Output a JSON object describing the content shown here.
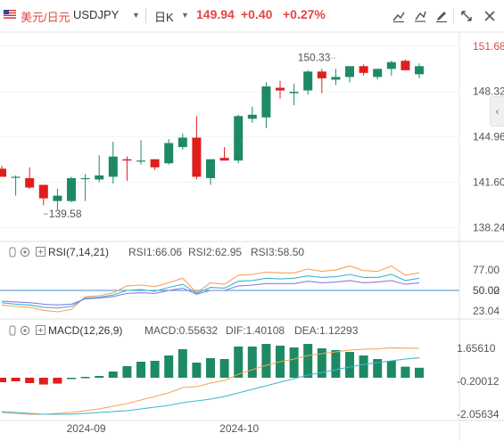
{
  "header": {
    "pair_name": "美元/日元",
    "symbol": "USDJPY",
    "period": "日K",
    "price": "149.94",
    "change": "+0.40",
    "change_pct": "+0.27%",
    "toolbar_icons": [
      "trend-line-icon",
      "bar-style-icon",
      "draw-icon",
      "eye-off-icon",
      "expand-icon",
      "close-icon"
    ]
  },
  "colors": {
    "up": "#1e8a63",
    "down": "#e01e1e",
    "accent_red": "#e34545",
    "rsi1": "#f5a35c",
    "rsi2": "#3cb6d6",
    "rsi3": "#8a7ee0",
    "macd_dif": "#f5a35c",
    "macd_dea": "#3cb6d6"
  },
  "chart_data": [
    {
      "type": "candlestick",
      "title": "",
      "y_ticks": [
        "151.68",
        "148.32",
        "144.96",
        "141.60",
        "138.24"
      ],
      "y_tick_values": [
        151.68,
        148.32,
        144.96,
        141.6,
        138.24
      ],
      "ylim": [
        137.8,
        152.2
      ],
      "x_ticks": [
        "2024-09",
        "2024-10"
      ],
      "x_tick_index": [
        6,
        17
      ],
      "annotations": [
        {
          "text": "150.33",
          "candle": 24,
          "value": 150.33,
          "kind": "high"
        },
        {
          "text": "139.58",
          "candle": 3,
          "value": 139.58,
          "kind": "low"
        }
      ],
      "candles": [
        {
          "o": 142.6,
          "h": 142.8,
          "l": 142.0,
          "c": 142.0
        },
        {
          "o": 142.0,
          "h": 142.1,
          "l": 140.6,
          "c": 142.0
        },
        {
          "o": 141.9,
          "h": 142.7,
          "l": 141.1,
          "c": 141.2
        },
        {
          "o": 141.4,
          "h": 141.4,
          "l": 139.9,
          "c": 140.4
        },
        {
          "o": 140.2,
          "h": 141.1,
          "l": 139.58,
          "c": 140.6
        },
        {
          "o": 140.2,
          "h": 142.0,
          "l": 140.1,
          "c": 141.9
        },
        {
          "o": 141.9,
          "h": 142.2,
          "l": 140.2,
          "c": 141.9
        },
        {
          "o": 141.8,
          "h": 143.6,
          "l": 141.6,
          "c": 142.1
        },
        {
          "o": 142.0,
          "h": 144.6,
          "l": 141.5,
          "c": 143.5
        },
        {
          "o": 143.3,
          "h": 143.5,
          "l": 141.7,
          "c": 143.2
        },
        {
          "o": 143.2,
          "h": 144.7,
          "l": 142.9,
          "c": 143.2
        },
        {
          "o": 143.3,
          "h": 143.3,
          "l": 142.5,
          "c": 142.7
        },
        {
          "o": 143.0,
          "h": 144.8,
          "l": 142.9,
          "c": 144.5
        },
        {
          "o": 144.2,
          "h": 145.2,
          "l": 144.0,
          "c": 144.9
        },
        {
          "o": 144.9,
          "h": 146.5,
          "l": 141.8,
          "c": 142.0
        },
        {
          "o": 141.9,
          "h": 143.3,
          "l": 141.4,
          "c": 143.3
        },
        {
          "o": 143.4,
          "h": 144.2,
          "l": 143.3,
          "c": 143.2
        },
        {
          "o": 143.2,
          "h": 146.6,
          "l": 143.0,
          "c": 146.5
        },
        {
          "o": 146.3,
          "h": 147.2,
          "l": 146.0,
          "c": 146.6
        },
        {
          "o": 146.4,
          "h": 149.0,
          "l": 145.6,
          "c": 148.7
        },
        {
          "o": 148.6,
          "h": 149.1,
          "l": 147.8,
          "c": 148.4
        },
        {
          "o": 148.2,
          "h": 148.9,
          "l": 147.3,
          "c": 148.3
        },
        {
          "o": 148.4,
          "h": 149.9,
          "l": 148.1,
          "c": 149.8
        },
        {
          "o": 149.8,
          "h": 150.0,
          "l": 148.2,
          "c": 149.3
        },
        {
          "o": 149.2,
          "h": 150.0,
          "l": 148.8,
          "c": 149.4
        },
        {
          "o": 149.4,
          "h": 150.1,
          "l": 149.0,
          "c": 150.2
        },
        {
          "o": 150.2,
          "h": 150.33,
          "l": 149.5,
          "c": 149.7
        },
        {
          "o": 149.4,
          "h": 150.0,
          "l": 149.2,
          "c": 150.0
        },
        {
          "o": 150.0,
          "h": 150.6,
          "l": 149.5,
          "c": 150.5
        },
        {
          "o": 150.6,
          "h": 150.7,
          "l": 149.9,
          "c": 149.9
        },
        {
          "o": 149.6,
          "h": 150.4,
          "l": 149.3,
          "c": 150.2
        }
      ]
    },
    {
      "type": "line",
      "indicator": "RSI",
      "label": "RSI(7,14,21)",
      "legend": [
        "RSI1:66.06",
        "RSI2:62.95",
        "RSI3:58.50"
      ],
      "y_ticks": [
        "77.00",
        "50.00",
        "23.04"
      ],
      "y_tick_values": [
        77.0,
        50.0,
        23.04
      ],
      "hline_value": 50.0,
      "hline_label": "50.02",
      "ylim": [
        15,
        92
      ],
      "series": [
        {
          "values": [
            31,
            29,
            28,
            24,
            22,
            25,
            42,
            43,
            47,
            56,
            57,
            55,
            60,
            66,
            47,
            60,
            58,
            70,
            71,
            74,
            73,
            73,
            78,
            75,
            77,
            82,
            76,
            75,
            82,
            70,
            73
          ]
        },
        {
          "values": [
            34,
            32,
            31,
            28,
            27,
            29,
            40,
            41,
            44,
            50,
            51,
            49,
            54,
            58,
            46,
            54,
            53,
            62,
            63,
            66,
            65,
            66,
            69,
            67,
            68,
            71,
            67,
            67,
            71,
            63,
            66
          ]
        },
        {
          "values": [
            36,
            35,
            34,
            32,
            31,
            32,
            39,
            40,
            42,
            46,
            47,
            46,
            50,
            53,
            45,
            50,
            50,
            56,
            57,
            59,
            59,
            59,
            62,
            60,
            61,
            63,
            60,
            61,
            63,
            58,
            60
          ]
        }
      ]
    },
    {
      "type": "bar",
      "indicator": "MACD",
      "label": "MACD(12,26,9)",
      "legend": [
        "MACD:0.55632",
        "DIF:1.40108",
        "DEA:1.12293"
      ],
      "y_ticks": [
        "1.65610",
        "-0.20012",
        "-2.05634"
      ],
      "y_tick_values": [
        1.6561,
        -0.20012,
        -2.05634
      ],
      "ylim": [
        -2.3,
        2.2
      ],
      "histogram": [
        -0.25,
        -0.2,
        -0.3,
        -0.38,
        -0.33,
        0.0,
        0.05,
        0.1,
        0.35,
        0.65,
        0.9,
        0.95,
        1.25,
        1.6,
        0.85,
        1.1,
        1.05,
        1.75,
        1.75,
        1.9,
        1.8,
        1.7,
        1.9,
        1.65,
        1.55,
        1.45,
        1.25,
        1.05,
        0.95,
        0.62,
        0.56
      ],
      "series": [
        {
          "values": [
            -1.95,
            -2.0,
            -2.05,
            -2.05,
            -2.0,
            -1.95,
            -1.85,
            -1.75,
            -1.6,
            -1.45,
            -1.25,
            -1.05,
            -0.85,
            -0.55,
            -0.5,
            -0.3,
            -0.15,
            0.2,
            0.45,
            0.7,
            0.9,
            1.05,
            1.25,
            1.35,
            1.45,
            1.55,
            1.6,
            1.62,
            1.68,
            1.66,
            1.65
          ]
        },
        {
          "values": [
            -1.9,
            -1.95,
            -2.0,
            -2.05,
            -2.05,
            -2.05,
            -2.0,
            -1.95,
            -1.9,
            -1.85,
            -1.75,
            -1.65,
            -1.55,
            -1.4,
            -1.3,
            -1.2,
            -1.05,
            -0.85,
            -0.65,
            -0.45,
            -0.25,
            -0.05,
            0.15,
            0.3,
            0.45,
            0.6,
            0.75,
            0.85,
            0.95,
            1.05,
            1.12
          ]
        }
      ]
    }
  ]
}
